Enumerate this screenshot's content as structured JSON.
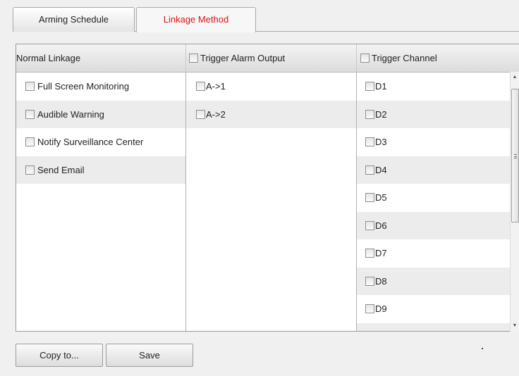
{
  "tabs": [
    {
      "label": "Arming Schedule",
      "active": false
    },
    {
      "label_part1": "Linka",
      "label_part2": "ge Method",
      "active": true
    }
  ],
  "columns": {
    "normal_linkage": "Normal Linkage",
    "trigger_alarm_output": "Trigger Alarm Output",
    "trigger_channel": "Trigger Channel"
  },
  "normal_linkage_items": [
    "Full Screen Monitoring",
    "Audible Warning",
    "Notify Surveillance Center",
    "Send Email"
  ],
  "alarm_output_items": [
    "A->1",
    "A->2"
  ],
  "channel_items": [
    "D1",
    "D2",
    "D3",
    "D4",
    "D5",
    "D6",
    "D7",
    "D8",
    "D9",
    ""
  ],
  "buttons": {
    "copy_to": "Copy to...",
    "save": "Save"
  },
  "colors": {
    "active_tab_text": "#e01010",
    "row_alt": "#ececec"
  }
}
